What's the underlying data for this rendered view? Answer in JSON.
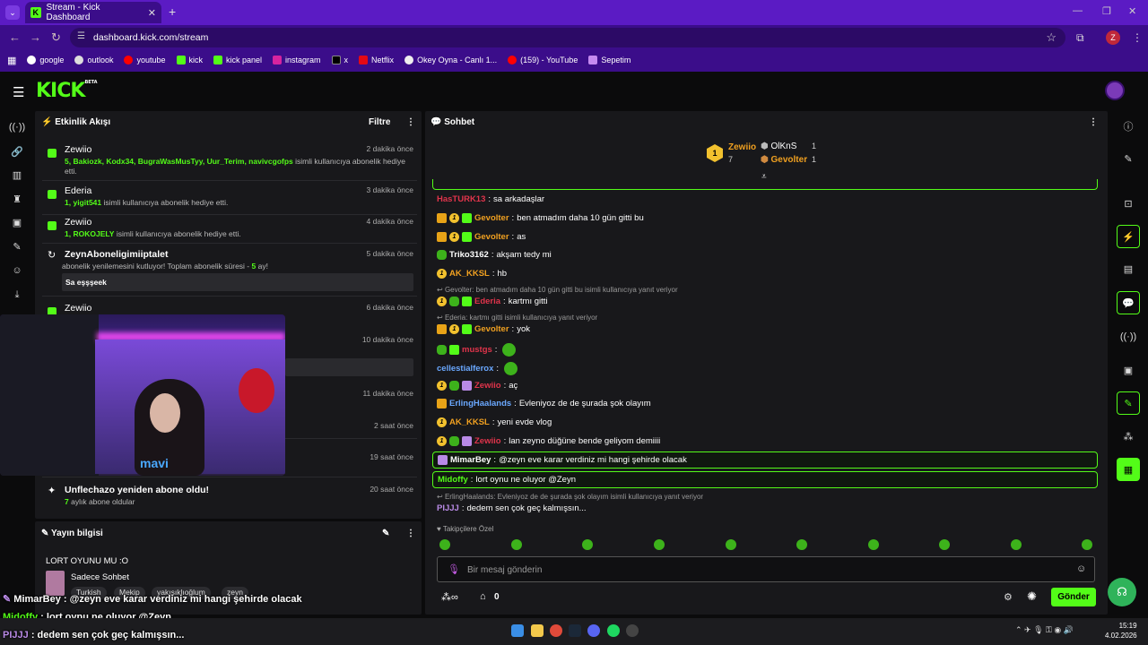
{
  "browser": {
    "tab_title": "Stream - Kick Dashboard",
    "url": "dashboard.kick.com/stream",
    "bookmarks": [
      "google",
      "outlook",
      "youtube",
      "kick",
      "kick panel",
      "instagram",
      "x",
      "Netflix",
      "Okey Oyna - Canlı 1...",
      "(159) - YouTube",
      "Sepetim"
    ],
    "profile_initial": "Z"
  },
  "logo": {
    "text": "KICK",
    "beta": "BETA"
  },
  "activity": {
    "title": "Etkinlik Akışı",
    "filter": "Filtre",
    "items": [
      {
        "name": "Zewiio",
        "time": "2 dakika önce",
        "count": "5,",
        "users": "Bakiozk, Kodx34, BugraWasMusTyy, Uur_Terim, navivcgofps",
        "text": "isimli kullanıcıya abonelik hediye etti."
      },
      {
        "name": "Ederia",
        "time": "3 dakika önce",
        "count": "1,",
        "users": "yigit541",
        "text": "isimli kullanıcıya abonelik hediye etti."
      },
      {
        "name": "Zewiio",
        "time": "4 dakika önce",
        "count": "1,",
        "users": "ROKOJELY",
        "text": "isimli kullanıcıya abonelik hediye etti."
      },
      {
        "name": "ZeynAboneligimiiptalet",
        "time": "5 dakika önce",
        "text": "abonelik yenilemesini kutluyor! Toplam abonelik süresi -",
        "months": "5",
        "tail": "ay!",
        "quote": "Sa eşşşeek"
      },
      {
        "name": "Zewiio",
        "time": "6 dakika önce"
      },
      {
        "time": "10 dakika önce"
      },
      {
        "time": "11 dakika önce"
      },
      {
        "time": "2 saat önce"
      },
      {
        "time": "19 saat önce"
      },
      {
        "name": "Unflechazo yeniden abone oldu!",
        "time": "20 saat önce",
        "months": "7",
        "text": "aylık abone oldular"
      }
    ]
  },
  "stream_info": {
    "title": "Yayın bilgisi",
    "stream_title": "LORT OYUNU MU :O",
    "category": "Sadece Sohbet",
    "tags": [
      "Turkish",
      "Mekip",
      "yakışıklıoğlum",
      "zeyn"
    ]
  },
  "webcam": {
    "shirt_text": "mavi"
  },
  "chat": {
    "title": "Sohbet",
    "leaderboard": [
      {
        "rank": "1",
        "name": "Zewiio",
        "count": "7"
      },
      {
        "name": "OlKnS",
        "count": "1"
      },
      {
        "name": "Gevolter",
        "count": "1"
      }
    ],
    "messages": [
      {
        "user": "HasTURK13",
        "color": "#e0344b",
        "text": "sa arkadaşlar",
        "badges": []
      },
      {
        "user": "Gevolter",
        "color": "#f0a020",
        "text": "ben atmadım daha 10 gün gitti bu",
        "badges": [
          "crown",
          "coin",
          "gift"
        ]
      },
      {
        "user": "Gevolter",
        "color": "#f0a020",
        "text": "as",
        "badges": [
          "crown",
          "coin",
          "gift"
        ]
      },
      {
        "user": "Triko3162",
        "color": "#ffffff",
        "text": "akşam tedy mi",
        "badges": [
          "frog"
        ]
      },
      {
        "user": "AK_KKSL",
        "color": "#f0a020",
        "text": "hb",
        "badges": [
          "coin"
        ]
      },
      {
        "reply": "Gevolter: ben atmadım daha 10 gün gitti bu isimli kullanıcıya yanıt veriyor"
      },
      {
        "user": "Ederia",
        "color": "#e0344b",
        "text": "kartmı gitti",
        "badges": [
          "coin",
          "frog",
          "gift"
        ]
      },
      {
        "reply": "Ederia: kartmı gitti isimli kullanıcıya yanıt veriyor"
      },
      {
        "user": "Gevolter",
        "color": "#f0a020",
        "text": "yok",
        "badges": [
          "crown",
          "coin",
          "gift"
        ]
      },
      {
        "user": "mustgs",
        "color": "#e0344b",
        "text": "",
        "badges": [
          "frog",
          "gift"
        ],
        "emote": true
      },
      {
        "user": "cellestialferox",
        "color": "#6aa8ff",
        "text": "",
        "badges": [],
        "emote": true
      },
      {
        "user": "Zewiio",
        "color": "#e0344b",
        "text": "aç",
        "badges": [
          "coin",
          "frog",
          "purp"
        ]
      },
      {
        "user": "ErlingHaalands",
        "color": "#6aa8ff",
        "text": "Evleniyoz de de şurada şok olayım",
        "badges": [
          "crown"
        ]
      },
      {
        "user": "AK_KKSL",
        "color": "#f0a020",
        "text": "yeni evde vlog",
        "badges": [
          "coin"
        ]
      },
      {
        "user": "Zewiio",
        "color": "#e0344b",
        "text": "lan zeyno düğüne bende geliyom demiiii",
        "badges": [
          "coin",
          "frog",
          "purp"
        ]
      }
    ],
    "highlight1": {
      "user": "MimarBey",
      "text": "@zeyn eve karar verdiniz mi hangi şehirde olacak"
    },
    "highlight2": {
      "user": "Midoffy",
      "text": "lort oynu ne oluyor @Zeyn"
    },
    "last_reply": "ErlingHaalands: Evleniyoz de de şurada şok olayım isimli kullanıcıya yanıt veriyor",
    "last": {
      "user": "PIJJJ",
      "text": "dedem sen çok geç kalmışsın..."
    },
    "emote_header": "Takipçilere Özel",
    "input_placeholder": "Bir mesaj gönderin",
    "viewer_count": "0",
    "send": "Gönder"
  },
  "overlay": [
    {
      "user": "MimarBey",
      "text": ": @zeyn eve karar verdiniz mi hangi şehirde olacak"
    },
    {
      "user": "Midoffy",
      "text": ": lort oynu ne oluyor @Zeyn"
    },
    {
      "user": "PIJJJ",
      "text": ": dedem sen çok geç kalmışsın..."
    }
  ],
  "taskbar": {
    "time": "15:19",
    "date": "4.02.2026"
  },
  "colors": {
    "accent": "#53fc18",
    "browser": "#3b0d8a",
    "bg": "#0b0b0c",
    "panel": "#18181b"
  }
}
